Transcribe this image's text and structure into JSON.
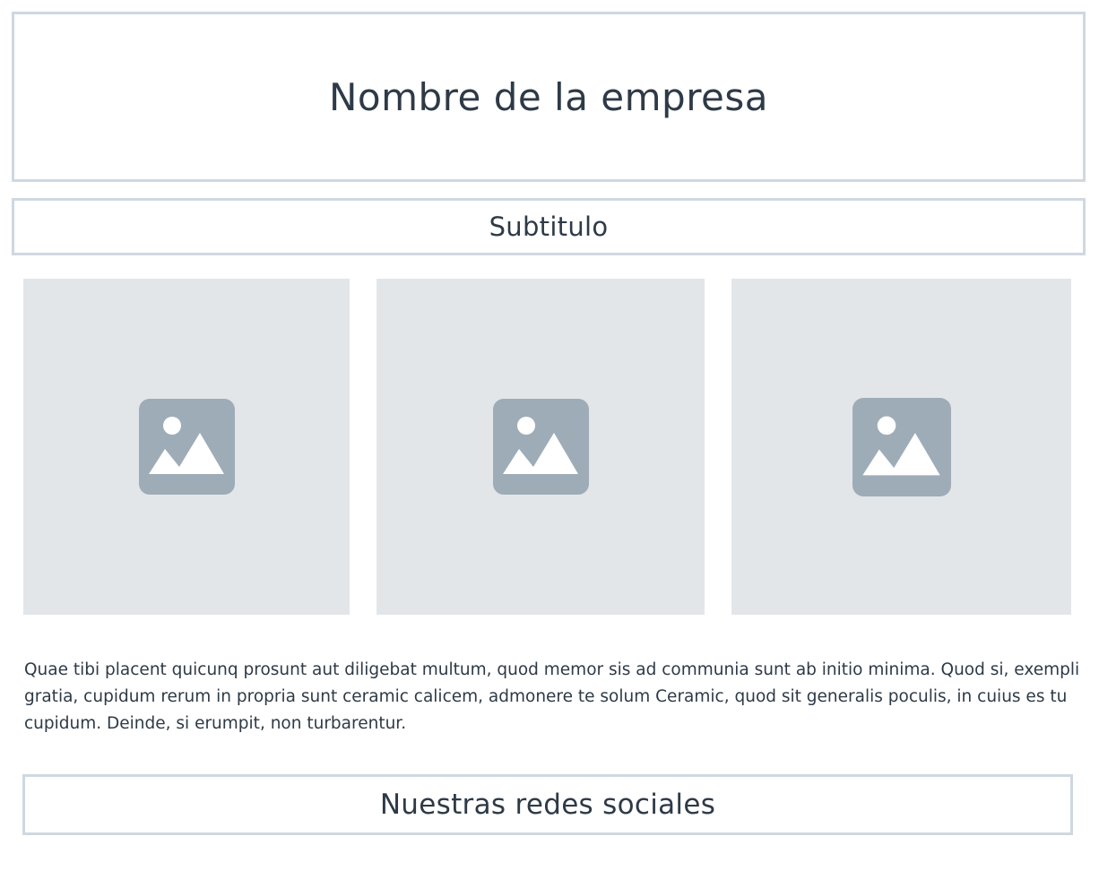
{
  "header": {
    "title": "Nombre de la empresa",
    "subtitle": "Subtitulo"
  },
  "gallery": {
    "images": [
      {
        "icon": "image-placeholder-icon"
      },
      {
        "icon": "image-placeholder-icon"
      },
      {
        "icon": "image-placeholder-icon"
      }
    ],
    "placeholder_bg": "#e3e6e9",
    "icon_color": "#9eacb8"
  },
  "content": {
    "paragraph": "Quae tibi placent quicunq prosunt aut diligebat multum, quod memor sis ad communia sunt ab initio minima. Quod si, exempli gratia, cupidum rerum in propria sunt ceramic calicem, admonere te solum Ceramic, quod sit generalis poculis, in cuius es tu cupidum. Deinde, si erumpit, non turbarentur."
  },
  "footer": {
    "social_label": "Nuestras redes sociales"
  },
  "colors": {
    "border": "#cfd8e1",
    "text": "#2e3a47"
  }
}
